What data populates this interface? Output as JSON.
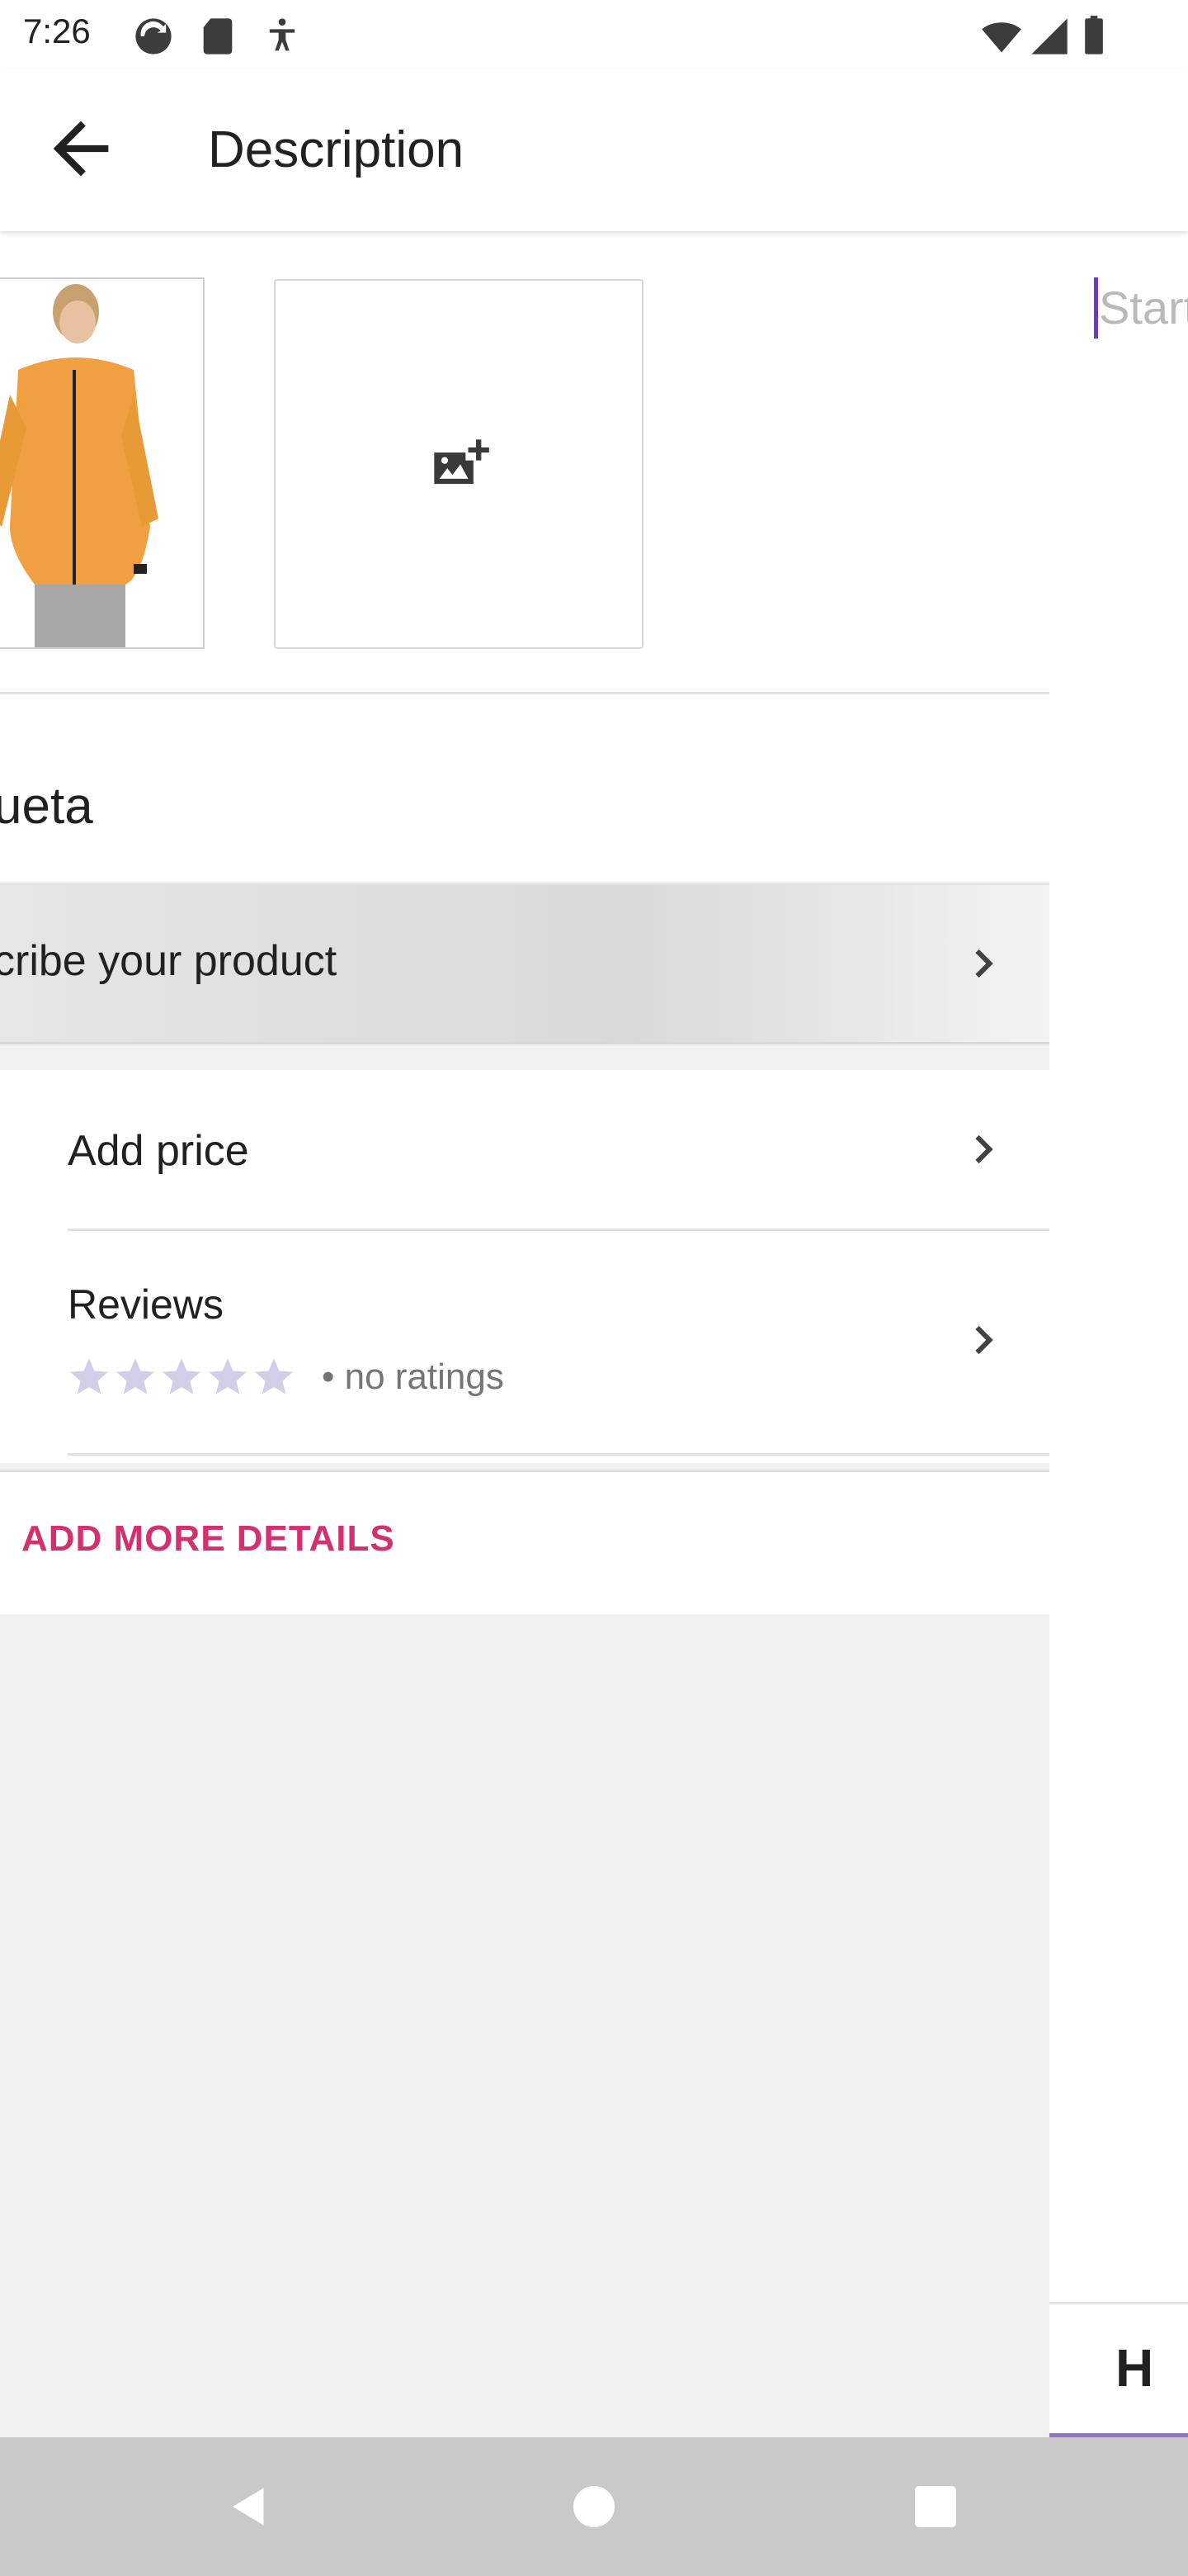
{
  "status_bar": {
    "time": "7:26",
    "icons": [
      "sync-icon",
      "sd-card-icon",
      "accessibility-icon",
      "wifi-icon",
      "signal-icon",
      "battery-icon"
    ]
  },
  "app_bar": {
    "title": "Description",
    "back_icon": "arrow-back-icon"
  },
  "product_page": {
    "name_partial": "ueta",
    "describe_label": "cribe your product",
    "add_photo_icon": "add-photo-icon",
    "price_label": "Add price",
    "reviews": {
      "title": "Reviews",
      "rating_text": "• no ratings",
      "stars_filled": 0,
      "stars_total": 5
    },
    "more_details_label": "ADD MORE DETAILS"
  },
  "editor": {
    "placeholder": "Start",
    "format_button": "H"
  },
  "colors": {
    "accent_pink": "#d2306f",
    "accent_purple": "#8e72cc",
    "star_empty": "#d4cdea"
  }
}
